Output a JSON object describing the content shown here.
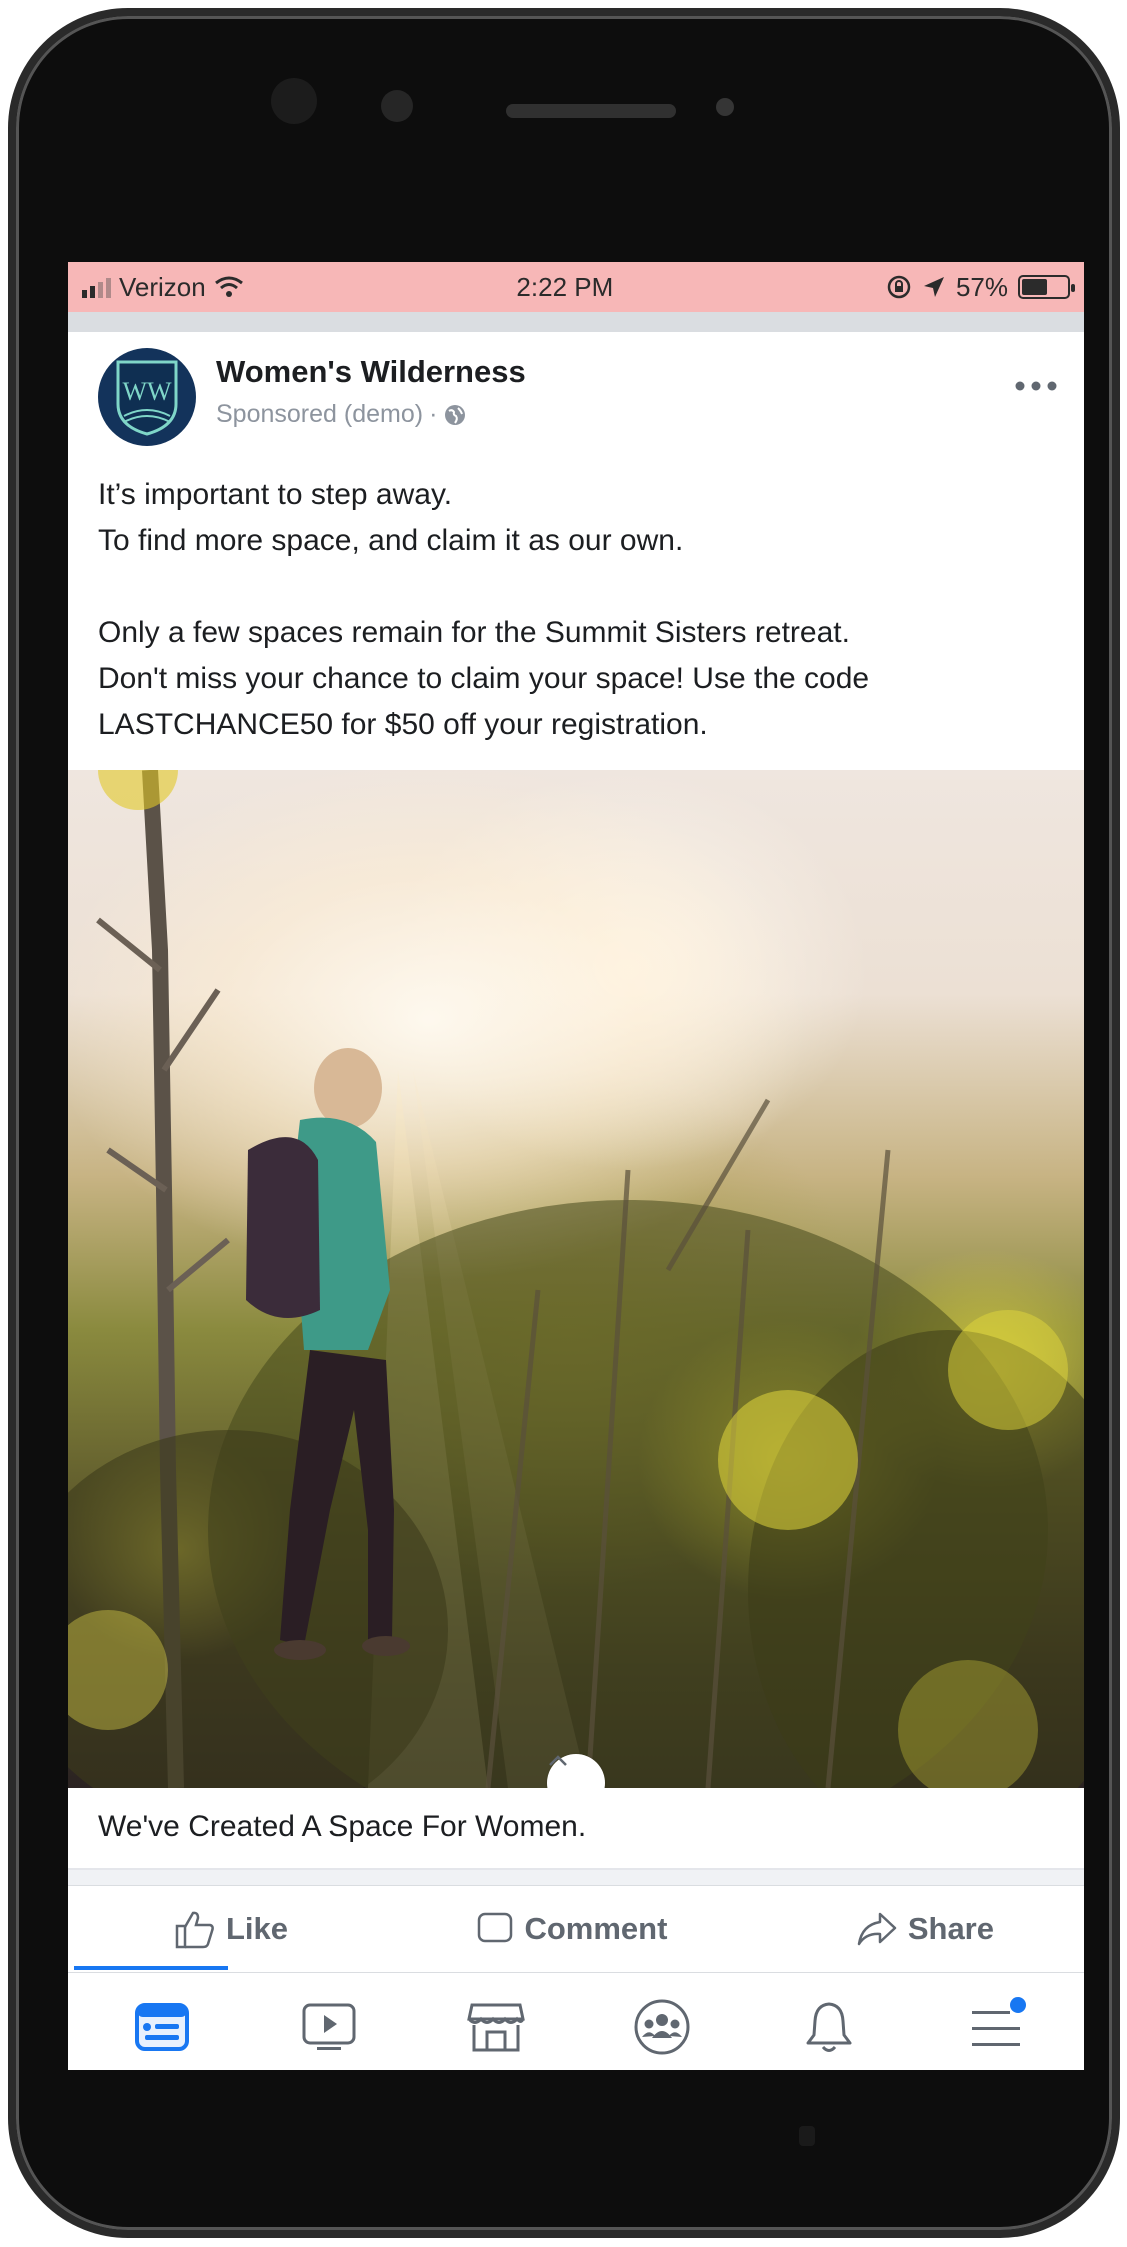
{
  "status_bar": {
    "carrier": "Verizon",
    "time": "2:22 PM",
    "battery": "57%",
    "battery_level": 0.57
  },
  "post": {
    "page_name": "Women's Wilderness",
    "avatar_initials": "WW",
    "sponsored_label": "Sponsored (demo)",
    "separator": "·",
    "more_icon": "more-dots-icon",
    "text_lines": [
      "It’s important to step away.",
      "To find more space, and claim it as our own.",
      "Only a few spaces remain for the Summit Sisters retreat.",
      "Don't miss your chance to claim your space! Use the code",
      "LASTCHANCE50 for $50 off your registration."
    ],
    "link_caption": "We've Created A Space For Women."
  },
  "actions": {
    "like": "Like",
    "comment": "Comment",
    "share": "Share"
  },
  "tab_bar": [
    {
      "icon": "news-feed-icon",
      "active": true
    },
    {
      "icon": "watch-icon",
      "active": false
    },
    {
      "icon": "marketplace-icon",
      "active": false
    },
    {
      "icon": "groups-icon",
      "active": false
    },
    {
      "icon": "notifications-icon",
      "active": false
    },
    {
      "icon": "menu-icon",
      "active": false
    }
  ],
  "colors": {
    "status_bar_bg": "#f7b7b7",
    "accent": "#1877f2",
    "avatar_bg": "#13335b",
    "text": "#1c1e21",
    "muted": "#606770"
  }
}
